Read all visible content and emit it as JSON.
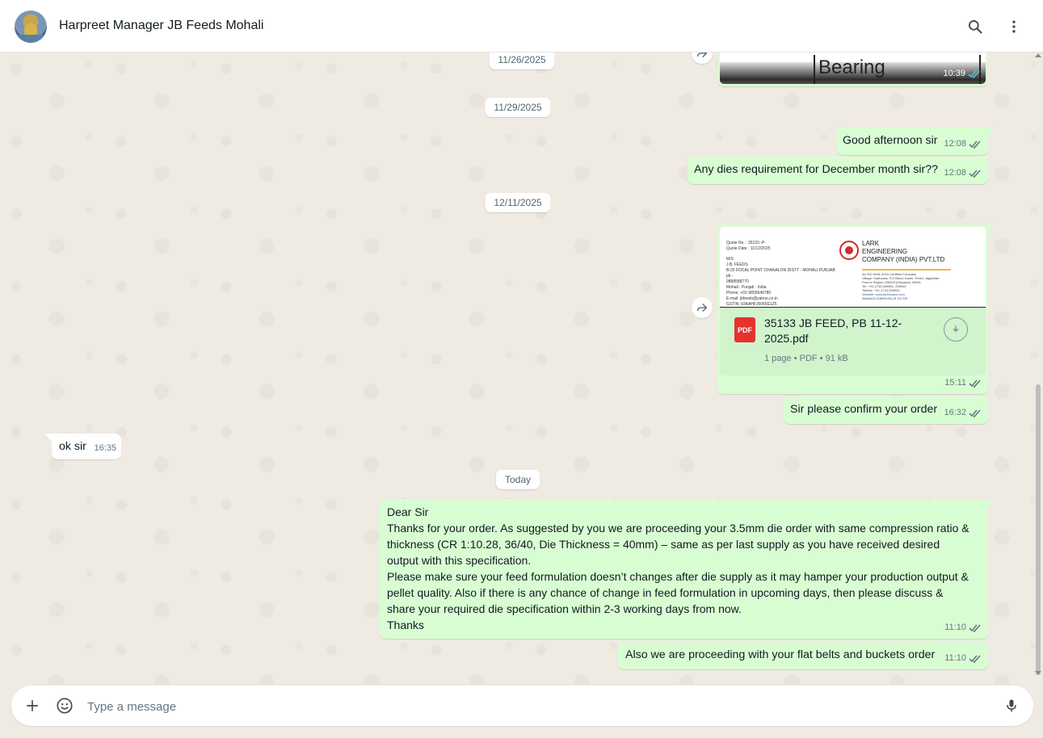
{
  "header": {
    "title": "Harpreet Manager JB Feeds Mohali"
  },
  "dates": {
    "d1": "11/26/2025",
    "d2": "11/29/2025",
    "d3": "12/11/2025",
    "d4": "Today"
  },
  "messages": {
    "bearing_image": {
      "image_text": "Bearing",
      "time": "10:39"
    },
    "m1": {
      "text": "Good afternoon sir",
      "time": "12:08"
    },
    "m2": {
      "text": "Any dies requirement for December month sir??",
      "time": "12:08"
    },
    "document": {
      "filename_line1": "35133 JB FEED, PB 11-12-",
      "filename_line2": "2025.pdf",
      "meta": "1 page • PDF • 91 kB",
      "pdf_badge": "PDF",
      "time": "15:11",
      "preview": {
        "quote_no": "Quote No. : 35133 -P-",
        "quote_date": "Quote Date : 11/12/2025",
        "to": "M/S",
        "company": "J.B. FEEDS",
        "addr": "B-25 FOCAL POINT CHANALON DISTT - MOHALI PUNJAB pb -",
        "phone_line": "9888588770",
        "city": "Mohali : Punjab : India",
        "phone": "Phone: +91-9855546780",
        "email": "E-mail: jbfeeds@yahoo.co.in",
        "gstin": "GSTIN: 03AAHFJ5055E1Z5",
        "vendor_line1": "LARK",
        "vendor_line2": "ENGINEERING",
        "vendor_line3": "COMPANY (INDIA) PVT.LTD",
        "cert": "An ISO 9001:2015 Certified Company",
        "vaddr1": "Village: Sadhaura, P.O.Bhud, Kaner, Tehsil: Jagadhari",
        "vaddr2": "Post ur Region 135003 (Haryana), INDIA",
        "vtel": "Tel: +91-1732-259801, 259544",
        "vfax": "Telefax: +91-1732-259001",
        "vweb": "Website: www.larkinsaco.com",
        "vgst": "06AAACL0189H1ZN-Z1 DX DS"
      }
    },
    "m3": {
      "text": "Sir please confirm your order",
      "time": "16:32"
    },
    "m4": {
      "text": "ok sir",
      "time": "16:35"
    },
    "m5": {
      "text": "Dear Sir\nThanks for your order. As suggested by you we are proceeding your 3.5mm die order with same compression ratio &\nthickness (CR 1:10.28, 36/40, Die Thickness = 40mm) – same as per last supply as you have received desired\noutput with this specification.\nPlease make sure your feed formulation doesn’t changes after die supply as it may hamper your production output &\npellet quality. Also if there is any chance of change in feed formulation in upcoming days, then please discuss &\nshare your required die specification within 2-3 working days from now.\nThanks",
      "time": "11:10"
    },
    "m6": {
      "text": "Also we are proceeding with your flat belts and buckets order",
      "time": "11:10"
    }
  },
  "composer": {
    "placeholder": "Type a message"
  },
  "icons": {
    "search": "search-icon",
    "menu": "more-vertical-icon",
    "add": "plus-icon",
    "sticker": "sticker-icon",
    "mic": "microphone-icon",
    "forward": "forward-icon",
    "download": "download-icon",
    "ticks": "double-check-icon"
  },
  "colors": {
    "outgoing": "#d9fdd3",
    "incoming": "#ffffff",
    "tick_blue": "#53bdeb",
    "pdf_red": "#e5322d"
  }
}
